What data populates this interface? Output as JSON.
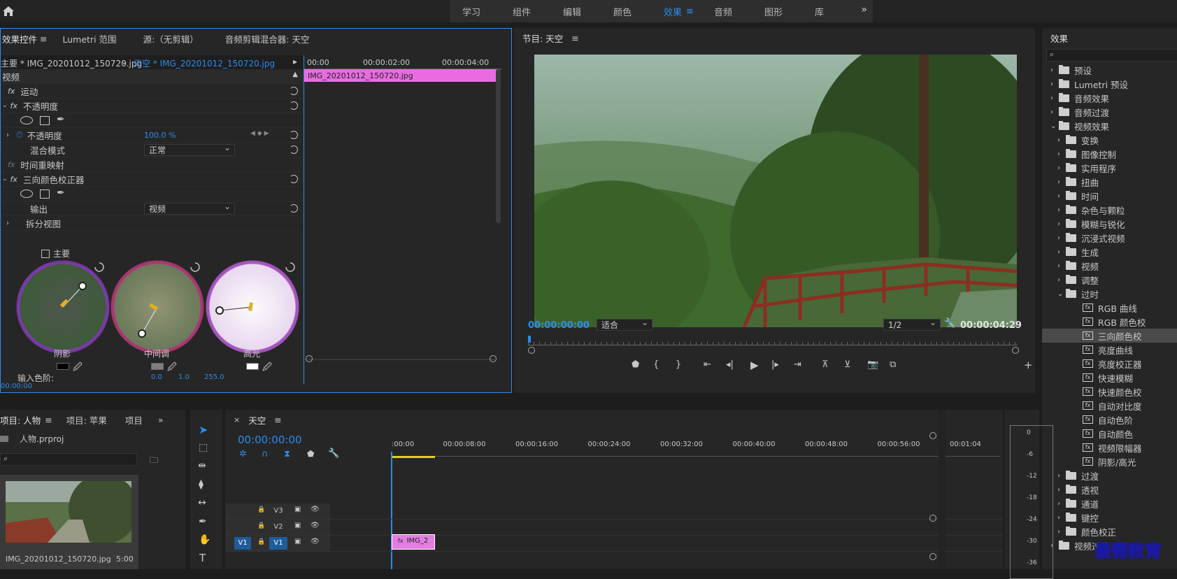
{
  "topbar": {
    "tabs": [
      "学习",
      "组件",
      "编辑",
      "颜色",
      "效果",
      "音频",
      "图形",
      "库"
    ],
    "active_index": 4,
    "more": "»"
  },
  "effect_controls": {
    "tabs": [
      "效果控件",
      "Lumetri 范围",
      "源:（无剪辑）",
      "音频剪辑混合器: 天空"
    ],
    "menu": "≡",
    "master_clip": "主要 * IMG_20201012_150720.jpg",
    "seq_clip": "天空 * IMG_20201012_150720.jpg",
    "ruler": [
      "00:00",
      "00:00:02:00",
      "00:00:04:00"
    ],
    "clip_bar": "IMG_20201012_150720.jpg",
    "video_label": "视频",
    "fx_motion": "运动",
    "fx_opacity": "不透明度",
    "opacity_prop": "不透明度",
    "opacity_value": "100.0 %",
    "blend_label": "混合模式",
    "blend_value": "正常",
    "time_remap": "时间重映射",
    "three_way": "三向颜色校正器",
    "output_label": "输出",
    "output_value": "视频",
    "split_view": "拆分视图",
    "master_checkbox": "主要",
    "wheels": [
      "阴影",
      "中间调",
      "高光"
    ],
    "input_levels_label": "输入色阶:",
    "input_levels": [
      "0.0",
      "1.0",
      "255.0"
    ],
    "timecode": "00:00:00"
  },
  "program": {
    "title": "节目: 天空",
    "menu": "≡",
    "timecode": "00:00:00:00",
    "fit": "适合",
    "resolution": "1/2",
    "duration": "00:00:04:29"
  },
  "effects_panel": {
    "title": "效果",
    "items": [
      {
        "label": "预设",
        "level": 0,
        "type": "folder"
      },
      {
        "label": "Lumetri 预设",
        "level": 0,
        "type": "folder"
      },
      {
        "label": "音频效果",
        "level": 0,
        "type": "folder"
      },
      {
        "label": "音频过渡",
        "level": 0,
        "type": "folder"
      },
      {
        "label": "视频效果",
        "level": 0,
        "type": "folder",
        "open": true
      },
      {
        "label": "变换",
        "level": 1,
        "type": "folder"
      },
      {
        "label": "图像控制",
        "level": 1,
        "type": "folder"
      },
      {
        "label": "实用程序",
        "level": 1,
        "type": "folder"
      },
      {
        "label": "扭曲",
        "level": 1,
        "type": "folder"
      },
      {
        "label": "时间",
        "level": 1,
        "type": "folder"
      },
      {
        "label": "杂色与颗粒",
        "level": 1,
        "type": "folder"
      },
      {
        "label": "模糊与锐化",
        "level": 1,
        "type": "folder"
      },
      {
        "label": "沉浸式视频",
        "level": 1,
        "type": "folder"
      },
      {
        "label": "生成",
        "level": 1,
        "type": "folder"
      },
      {
        "label": "视频",
        "level": 1,
        "type": "folder"
      },
      {
        "label": "调整",
        "level": 1,
        "type": "folder"
      },
      {
        "label": "过时",
        "level": 1,
        "type": "folder",
        "open": true
      },
      {
        "label": "RGB 曲线",
        "level": 2,
        "type": "fx"
      },
      {
        "label": "RGB 颜色校",
        "level": 2,
        "type": "fx"
      },
      {
        "label": "三向颜色校",
        "level": 2,
        "type": "fx",
        "selected": true
      },
      {
        "label": "亮度曲线",
        "level": 2,
        "type": "fx"
      },
      {
        "label": "亮度校正器",
        "level": 2,
        "type": "fx"
      },
      {
        "label": "快速模糊",
        "level": 2,
        "type": "fx"
      },
      {
        "label": "快速颜色校",
        "level": 2,
        "type": "fx"
      },
      {
        "label": "自动对比度",
        "level": 2,
        "type": "fx"
      },
      {
        "label": "自动色阶",
        "level": 2,
        "type": "fx"
      },
      {
        "label": "自动颜色",
        "level": 2,
        "type": "fx"
      },
      {
        "label": "视频限幅器",
        "level": 2,
        "type": "fx"
      },
      {
        "label": "阴影/高光",
        "level": 2,
        "type": "fx"
      },
      {
        "label": "过渡",
        "level": 1,
        "type": "folder"
      },
      {
        "label": "透视",
        "level": 1,
        "type": "folder"
      },
      {
        "label": "通道",
        "level": 1,
        "type": "folder"
      },
      {
        "label": "键控",
        "level": 1,
        "type": "folder"
      },
      {
        "label": "颜色校正",
        "level": 1,
        "type": "folder"
      },
      {
        "label": "视频过渡",
        "level": 0,
        "type": "folder"
      }
    ]
  },
  "project": {
    "tabs": [
      "项目: 人物",
      "项目: 苹果",
      "项目"
    ],
    "menu": "≡",
    "file": "人物.prproj",
    "clip_name": "IMG_20201012_150720.jpg",
    "clip_duration": "5:00",
    "more": "»"
  },
  "timeline": {
    "title": "天空",
    "menu": "≡",
    "close": "×",
    "timecode": "00:00:00:00",
    "ruler": [
      ":00:00",
      "00:00:08:00",
      "00:00:16:00",
      "00:00:24:00",
      "00:00:32:00",
      "00:00:40:00",
      "00:00:48:00",
      "00:00:56:00",
      "00:01:04"
    ],
    "tracks": [
      {
        "name": "V3",
        "src": ""
      },
      {
        "name": "V2",
        "src": ""
      },
      {
        "name": "V1",
        "src": "V1"
      }
    ],
    "clip": "IMG_2"
  },
  "meter": {
    "scale": [
      "0",
      "-6",
      "-12",
      "-18",
      "-24",
      "-30",
      "-36"
    ]
  },
  "watermark": "最需教育"
}
